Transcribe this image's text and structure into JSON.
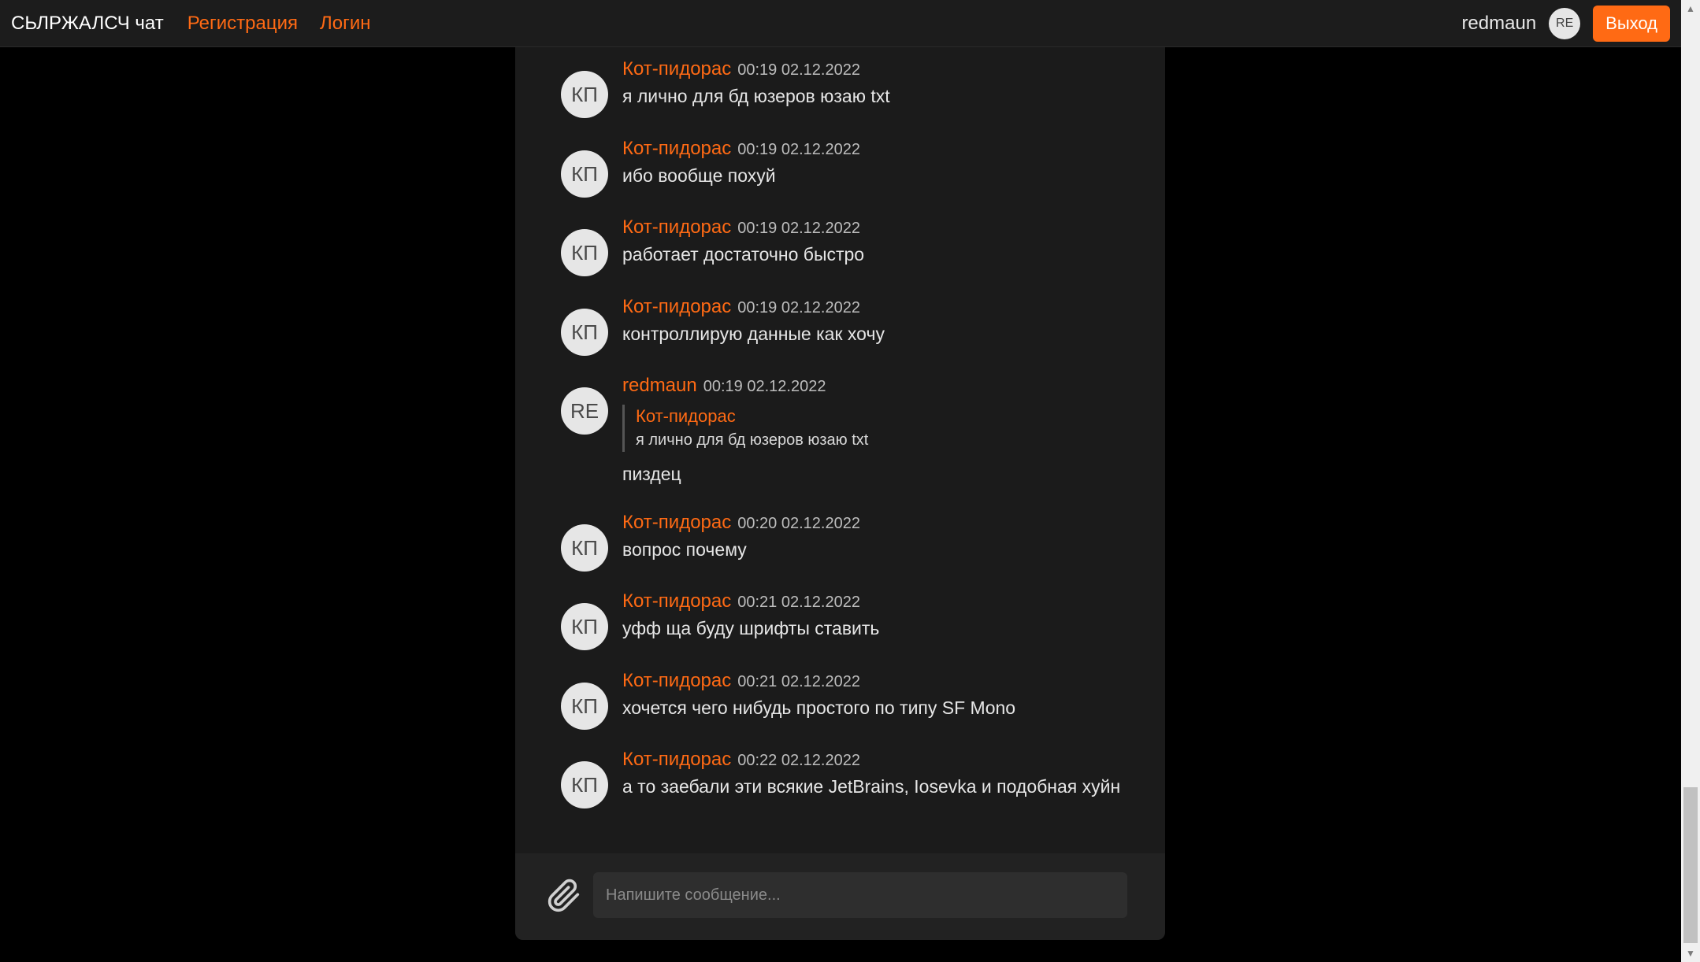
{
  "nav": {
    "brand": "СЬЛРЖАЛСЧ чат",
    "register": "Регистрация",
    "login": "Логин",
    "username": "redmaun",
    "avatar_initials": "RE",
    "logout": "Выход"
  },
  "messages": [
    {
      "initials": "КП",
      "author": "Кот-пидорас",
      "time": "00:19 02.12.2022",
      "text": "я лично для бд юзеров юзаю txt"
    },
    {
      "initials": "КП",
      "author": "Кот-пидорас",
      "time": "00:19 02.12.2022",
      "text": "ибо вообще похуй"
    },
    {
      "initials": "КП",
      "author": "Кот-пидорас",
      "time": "00:19 02.12.2022",
      "text": "работает достаточно быстро"
    },
    {
      "initials": "КП",
      "author": "Кот-пидорас",
      "time": "00:19 02.12.2022",
      "text": "контроллирую данные как хочу"
    },
    {
      "initials": "RE",
      "author": "redmaun",
      "time": "00:19 02.12.2022",
      "quote_author": "Кот-пидорас",
      "quote_text": "я лично для бд юзеров юзаю txt",
      "text": "пиздец"
    },
    {
      "initials": "КП",
      "author": "Кот-пидорас",
      "time": "00:20 02.12.2022",
      "text": "вопрос почему"
    },
    {
      "initials": "КП",
      "author": "Кот-пидорас",
      "time": "00:21 02.12.2022",
      "text": "уфф ща буду шрифты ставить"
    },
    {
      "initials": "КП",
      "author": "Кот-пидорас",
      "time": "00:21 02.12.2022",
      "text": "хочется чего нибудь простого по типу SF Mono"
    },
    {
      "initials": "КП",
      "author": "Кот-пидорас",
      "time": "00:22 02.12.2022",
      "text": "а то заебали эти всякие JetBrains, Iosevka и подобная хуйн"
    }
  ],
  "composer": {
    "placeholder": "Напишите сообщение...",
    "attach_icon": "paperclip-icon"
  },
  "colors": {
    "accent": "#ff6a14",
    "panel": "#1b1b1b",
    "background": "#000000"
  }
}
